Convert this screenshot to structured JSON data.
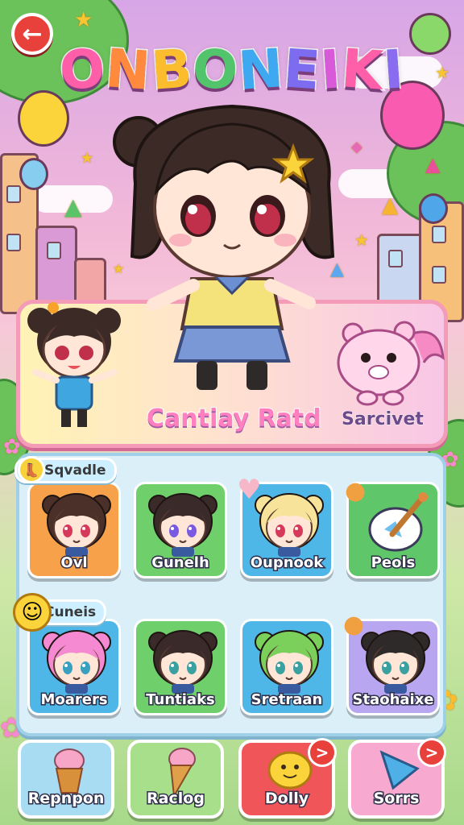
{
  "header": {
    "back_icon": "arrow-left-icon",
    "title_letters": [
      "O",
      "N",
      "B",
      "O",
      "N",
      "E",
      "I",
      "K",
      "I"
    ],
    "title_colors": [
      "#ff5fa8",
      "#ff8a3d",
      "#fbbd2e",
      "#52c46b",
      "#3ea8f0",
      "#7d6cf0",
      "#d95ad8",
      "#ff5fa8",
      "#8a6cf0"
    ]
  },
  "featured": {
    "title": "Cantiay Ratd",
    "subtitle": "Sarcivet"
  },
  "sections": {
    "first_label": "Sqvadle",
    "second_label": "Cuneis"
  },
  "tiles": [
    {
      "name": "Ovl",
      "color": "#f7a24a",
      "hair": "#4a3028",
      "eyes": "#d63a5a"
    },
    {
      "name": "Gunelh",
      "color": "#6fcf6a",
      "hair": "#3a2a2a",
      "eyes": "#7a5ae0"
    },
    {
      "name": "Oupnook",
      "color": "#4fb7e8",
      "hair": "#f7e39a",
      "eyes": "#d63a5a"
    },
    {
      "name": "Peols",
      "color": "#5fc76a",
      "icon": "bowl-icon"
    },
    {
      "name": "Moarers",
      "color": "#4fb7e8",
      "hair": "#f58ad2",
      "eyes": "#3aa0c0"
    },
    {
      "name": "Tuntiaks",
      "color": "#6fcf6a",
      "hair": "#3a2a2a",
      "eyes": "#3aa0a0"
    },
    {
      "name": "Sretraan",
      "color": "#4fb7e8",
      "hair": "#7ad05a",
      "eyes": "#3aa0a0"
    },
    {
      "name": "Staohaixe",
      "color": "#b9a6f0",
      "hair": "#2f2a2a",
      "eyes": "#3aa0a0"
    }
  ],
  "bottom_buttons": [
    {
      "name": "Repnpon",
      "color": "#a8dcf2",
      "icon": "ice-cream-cup-icon"
    },
    {
      "name": "Raclog",
      "color": "#a7df8a",
      "icon": "ice-cream-cone-icon"
    },
    {
      "name": "Dolly",
      "color": "#f0555a",
      "icon": "smiley-star-icon",
      "badge": ">"
    },
    {
      "name": "Sorrs",
      "color": "#f8a9cf",
      "icon": "triangle-icon",
      "badge": ">"
    }
  ]
}
